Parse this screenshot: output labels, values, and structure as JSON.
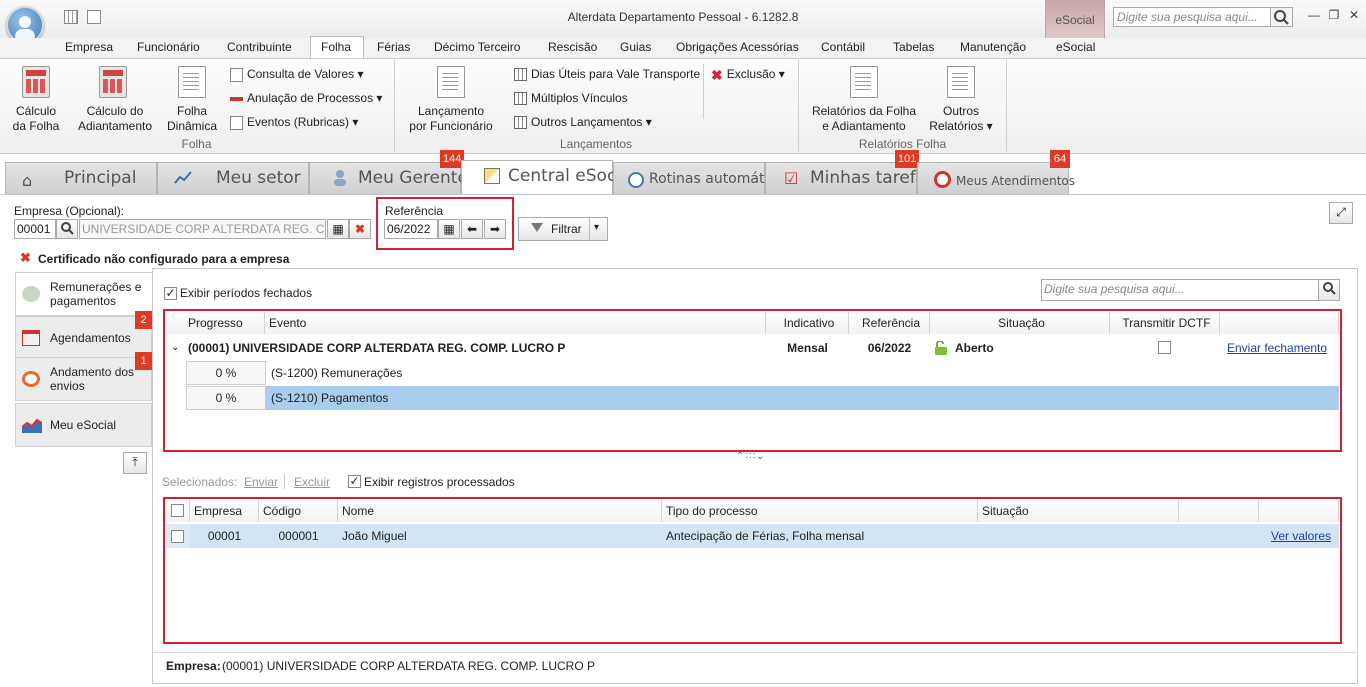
{
  "window": {
    "title": "Alterdata Departamento Pessoal - 6.1282.8",
    "context_tab": "eSocial",
    "search_placeholder": "Digite sua pesquisa aqui..."
  },
  "menu": {
    "items": [
      "Empresa",
      "Funcionário",
      "Contribuinte",
      "Folha",
      "Férias",
      "Décimo Terceiro",
      "Rescisão",
      "Guias",
      "Obrigações Acessórias",
      "Contábil",
      "Tabelas",
      "Manutenção",
      "eSocial"
    ],
    "active": "Folha"
  },
  "ribbon": {
    "folha": {
      "calc_folha": [
        "Cálculo",
        "da Folha"
      ],
      "calc_adiant": [
        "Cálculo do",
        "Adiantamento"
      ],
      "folha_din": [
        "Folha",
        "Dinâmica"
      ],
      "consulta": "Consulta de Valores",
      "anulacao": "Anulação de Processos",
      "eventos": "Eventos (Rubricas)",
      "group": "Folha"
    },
    "lanc": {
      "por_func": [
        "Lançamento",
        "por Funcionário"
      ],
      "dias_uteis": "Dias Úteis para Vale Transporte",
      "multiplos": "Múltiplos Vínculos",
      "outros": "Outros Lançamentos",
      "exclusao": "Exclusão",
      "group": "Lançamentos"
    },
    "rel": {
      "rel_folha": [
        "Relatórios da Folha",
        "e Adiantamento"
      ],
      "outros_rel": [
        "Outros",
        "Relatórios"
      ],
      "group": "Relatórios Folha"
    }
  },
  "tabs": [
    {
      "label": "Principal"
    },
    {
      "label": "Meu setor"
    },
    {
      "label": "Meu Gerente",
      "badge": "144"
    },
    {
      "label": "Central eSocial"
    },
    {
      "label": "Rotinas automáticas"
    },
    {
      "label": "Minhas tarefas",
      "badge": "101"
    },
    {
      "label": "Meus Atendimentos",
      "badge": "64"
    }
  ],
  "filters": {
    "empresa_label": "Empresa (Opcional):",
    "empresa_code": "00001",
    "empresa_name": "UNIVERSIDADE CORP ALTERDATA REG. COMP",
    "referencia_label": "Referência",
    "referencia": "06/2022",
    "filtrar": "Filtrar"
  },
  "warning": "Certificado não configurado para a empresa",
  "side": [
    {
      "label": "Remunerações e pagamentos"
    },
    {
      "label": "Agendamentos",
      "badge": "2"
    },
    {
      "label": "Andamento dos envios",
      "badge": "1"
    },
    {
      "label": "Meu eSocial"
    }
  ],
  "top_grid": {
    "show_closed": "Exibir períodos fechados",
    "search_placeholder": "Digite sua pesquisa aqui...",
    "headers": [
      "Progresso",
      "Evento",
      "Indicativo",
      "Referência",
      "Situação",
      "Transmitir DCTF"
    ],
    "group": {
      "title": "(00001) UNIVERSIDADE CORP ALTERDATA REG. COMP. LUCRO P",
      "indicativo": "Mensal",
      "referencia": "06/2022",
      "situacao": "Aberto",
      "link": "Enviar fechamento"
    },
    "rows": [
      {
        "progresso": "0 %",
        "evento": "(S-1200) Remunerações"
      },
      {
        "progresso": "0 %",
        "evento": "(S-1210) Pagamentos"
      }
    ]
  },
  "bottom_grid": {
    "selecionados": "Selecionados:",
    "enviar": "Enviar",
    "excluir": "Excluir",
    "show_processed": "Exibir registros processados",
    "headers": [
      "Empresa",
      "Código",
      "Nome",
      "Tipo do processo",
      "Situação"
    ],
    "rows": [
      {
        "empresa": "00001",
        "codigo": "000001",
        "nome": "João Miguel",
        "tipo": "Antecipação de Férias, Folha mensal",
        "situacao": "",
        "link": "Ver valores"
      }
    ]
  },
  "footer": {
    "label": "Empresa:",
    "value": "(00001) UNIVERSIDADE CORP ALTERDATA REG. COMP. LUCRO P"
  }
}
